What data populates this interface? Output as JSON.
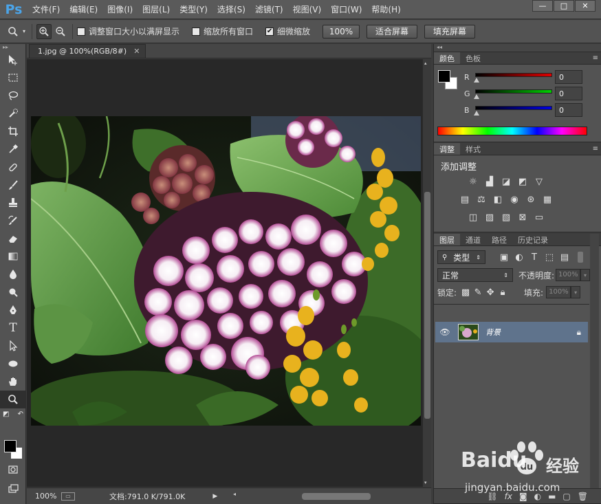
{
  "app": {
    "logo": "Ps"
  },
  "menu": [
    "文件(F)",
    "编辑(E)",
    "图像(I)",
    "图层(L)",
    "类型(Y)",
    "选择(S)",
    "滤镜(T)",
    "视图(V)",
    "窗口(W)",
    "帮助(H)"
  ],
  "window_controls": [
    "minimize-icon",
    "maximize-icon",
    "close-icon"
  ],
  "options": {
    "chk_resize": "调整窗口大小以满屏显示",
    "chk_all": "缩放所有窗口",
    "chk_scrubby": "细微缩放",
    "chk_resize_checked": false,
    "chk_all_checked": false,
    "chk_scrubby_checked": true,
    "btn_100": "100%",
    "btn_fit": "适合屏幕",
    "btn_fill": "填充屏幕"
  },
  "document": {
    "tab_title": "1.jpg @ 100%(RGB/8#)",
    "zoom": "100%",
    "info": "文档:791.0 K/791.0K"
  },
  "color_panel": {
    "tabs": [
      "颜色",
      "色板"
    ],
    "sliders": [
      {
        "label": "R",
        "value": "0",
        "color": "#e00000"
      },
      {
        "label": "G",
        "value": "0",
        "color": "#00d000"
      },
      {
        "label": "B",
        "value": "0",
        "color": "#0000e0"
      }
    ]
  },
  "adjustments_panel": {
    "tabs": [
      "调整",
      "样式"
    ],
    "title": "添加调整"
  },
  "layers_panel": {
    "tabs": [
      "图层",
      "通道",
      "路径",
      "历史记录"
    ],
    "filter_label": "类型",
    "blend_mode": "正常",
    "opacity_label": "不透明度:",
    "opacity_value": "100%",
    "lock_label": "锁定:",
    "fill_label": "填充:",
    "fill_value": "100%",
    "layer_name": "背景"
  },
  "watermark": {
    "brand": "Baidu",
    "brand_cn": "经验",
    "url": "jingyan.baidu.com"
  }
}
